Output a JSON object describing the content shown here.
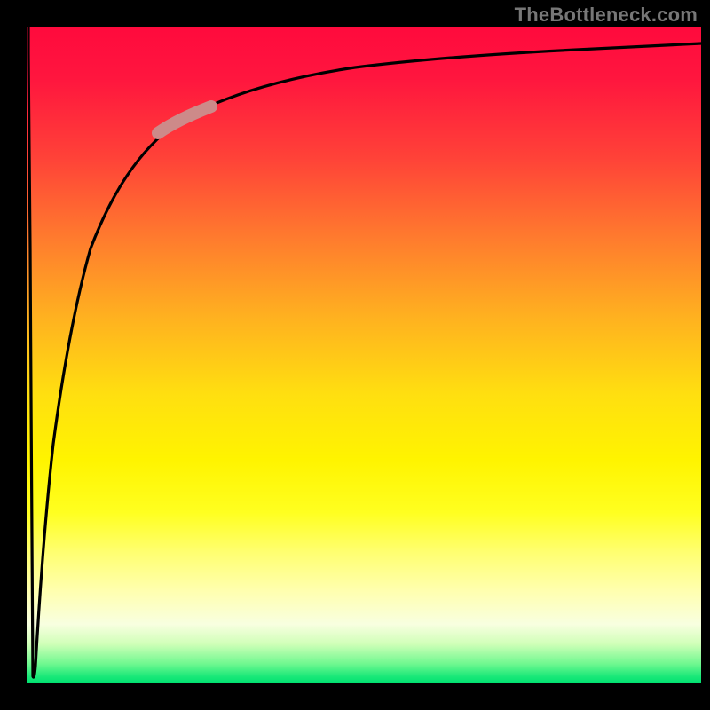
{
  "watermark": "TheBottleneck.com",
  "chart_data": {
    "type": "line",
    "title": "",
    "xlabel": "",
    "ylabel": "",
    "xlim": [
      0,
      100
    ],
    "ylim": [
      0,
      100
    ],
    "grid": false,
    "legend": false,
    "annotations": [],
    "series": [
      {
        "name": "bottleneck-curve",
        "x": [
          0,
          0.5,
          1,
          1.5,
          2,
          3,
          4,
          5,
          7,
          10,
          15,
          20,
          30,
          40,
          50,
          60,
          70,
          80,
          90,
          100
        ],
        "y": [
          100,
          30,
          0,
          30,
          50,
          66,
          74,
          79,
          83,
          86,
          88.5,
          90,
          92,
          93.2,
          94,
          94.6,
          95.2,
          95.7,
          96.2,
          96.6
        ]
      },
      {
        "name": "highlight-segment",
        "x": [
          20,
          27
        ],
        "y": [
          84.5,
          87
        ]
      }
    ],
    "background_gradient": {
      "direction": "vertical",
      "stops": [
        {
          "pos": 0.0,
          "color": "#ff0a3d"
        },
        {
          "pos": 0.5,
          "color": "#ffdf10"
        },
        {
          "pos": 0.93,
          "color": "#ffffd0"
        },
        {
          "pos": 1.0,
          "color": "#00e070"
        }
      ]
    },
    "highlight_color": "#cd8a89"
  }
}
